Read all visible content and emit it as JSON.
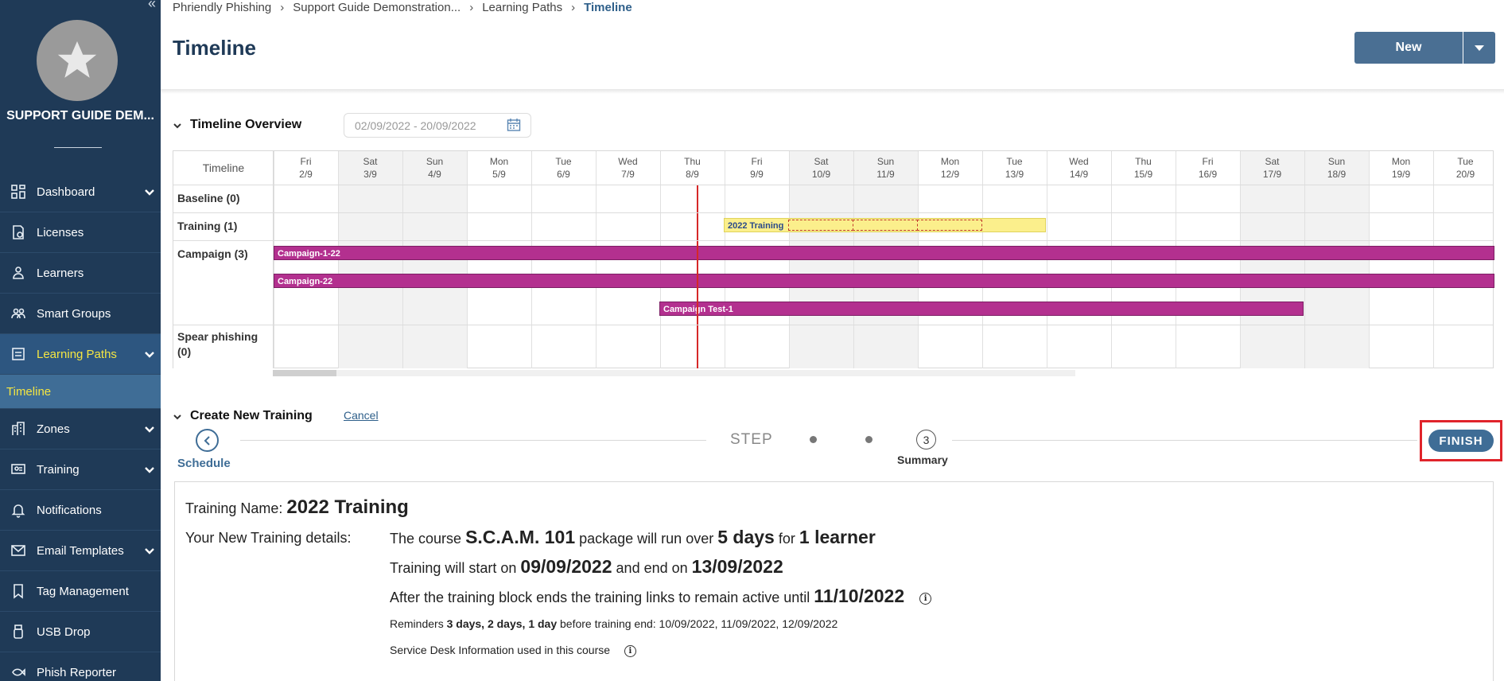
{
  "sidebar": {
    "collapse_glyph": "«",
    "org_name": "SUPPORT GUIDE DEM...",
    "items": [
      {
        "label": "Dashboard",
        "icon": "dashboard-icon",
        "has_chevron": true
      },
      {
        "label": "Licenses",
        "icon": "license-icon",
        "has_chevron": false
      },
      {
        "label": "Learners",
        "icon": "learners-icon",
        "has_chevron": false
      },
      {
        "label": "Smart Groups",
        "icon": "groups-icon",
        "has_chevron": false
      },
      {
        "label": "Learning Paths",
        "icon": "learning-paths-icon",
        "has_chevron": true,
        "active": true
      },
      {
        "label": "Zones",
        "icon": "zones-icon",
        "has_chevron": true
      },
      {
        "label": "Training",
        "icon": "training-icon",
        "has_chevron": true
      },
      {
        "label": "Notifications",
        "icon": "bell-icon",
        "has_chevron": false
      },
      {
        "label": "Email Templates",
        "icon": "email-icon",
        "has_chevron": true
      },
      {
        "label": "Tag Management",
        "icon": "tag-icon",
        "has_chevron": false
      },
      {
        "label": "USB Drop",
        "icon": "usb-icon",
        "has_chevron": false
      },
      {
        "label": "Phish Reporter",
        "icon": "phish-reporter-icon",
        "has_chevron": false
      }
    ],
    "sub_item": "Timeline",
    "colors": {
      "bg": "#1f3a57",
      "active_text": "#f5e642"
    }
  },
  "breadcrumb": [
    "Phriendly Phishing",
    "Support Guide Demonstration...",
    "Learning Paths",
    "Timeline"
  ],
  "breadcrumb_sep": "›",
  "page_title": "Timeline",
  "new_button": "New",
  "overview": {
    "title": "Timeline Overview",
    "date_range": "02/09/2022 - 20/09/2022"
  },
  "timeline": {
    "header_label": "Timeline",
    "days": [
      {
        "dow": "Fri",
        "date": "2/9",
        "weekend": false
      },
      {
        "dow": "Sat",
        "date": "3/9",
        "weekend": true
      },
      {
        "dow": "Sun",
        "date": "4/9",
        "weekend": true
      },
      {
        "dow": "Mon",
        "date": "5/9",
        "weekend": false
      },
      {
        "dow": "Tue",
        "date": "6/9",
        "weekend": false
      },
      {
        "dow": "Wed",
        "date": "7/9",
        "weekend": false
      },
      {
        "dow": "Thu",
        "date": "8/9",
        "weekend": false
      },
      {
        "dow": "Fri",
        "date": "9/9",
        "weekend": false
      },
      {
        "dow": "Sat",
        "date": "10/9",
        "weekend": true
      },
      {
        "dow": "Sun",
        "date": "11/9",
        "weekend": true
      },
      {
        "dow": "Mon",
        "date": "12/9",
        "weekend": false
      },
      {
        "dow": "Tue",
        "date": "13/9",
        "weekend": false
      },
      {
        "dow": "Wed",
        "date": "14/9",
        "weekend": false
      },
      {
        "dow": "Thu",
        "date": "15/9",
        "weekend": false
      },
      {
        "dow": "Fri",
        "date": "16/9",
        "weekend": false
      },
      {
        "dow": "Sat",
        "date": "17/9",
        "weekend": true
      },
      {
        "dow": "Sun",
        "date": "18/9",
        "weekend": true
      },
      {
        "dow": "Mon",
        "date": "19/9",
        "weekend": false
      },
      {
        "dow": "Tue",
        "date": "20/9",
        "weekend": false
      }
    ],
    "rows": [
      {
        "label": "Baseline (0)"
      },
      {
        "label": "Training (1)"
      },
      {
        "label": "Campaign (3)"
      },
      {
        "label": "Spear phishing (0)"
      }
    ],
    "bars": {
      "training": {
        "label": "2022 Training"
      },
      "campaign1": {
        "label": "Campaign-1-22"
      },
      "campaign2": {
        "label": "Campaign-22"
      },
      "campaign3": {
        "label": "Campaign Test-1"
      }
    },
    "colors": {
      "campaign": "#b3308f",
      "training": "#fbef8c",
      "today": "#d62828"
    }
  },
  "create": {
    "title": "Create New Training",
    "cancel": "Cancel",
    "step_word": "STEP",
    "step_number": "3",
    "back_label": "Schedule",
    "summary_label": "Summary",
    "finish": "FINISH"
  },
  "summary": {
    "name_label": "Training Name:",
    "name_value": "2022 Training",
    "details_label": "Your New Training details:",
    "l1_a": "The course",
    "l1_course": "S.C.A.M. 101",
    "l1_b": "package will run over",
    "l1_days": "5 days",
    "l1_c": "for",
    "l1_learners": "1 learner",
    "l2_a": "Training will start on",
    "l2_start": "09/09/2022",
    "l2_b": "and end on",
    "l2_end": "13/09/2022",
    "l3_a": "After the training block ends the training links to remain active until",
    "l3_date": "11/10/2022",
    "l4_a": "Reminders",
    "l4_b": "3 days, 2 days, 1 day",
    "l4_c": "before training end: 10/09/2022, 11/09/2022, 12/09/2022",
    "l5": "Service Desk Information used in this course",
    "info_glyph": "i"
  }
}
